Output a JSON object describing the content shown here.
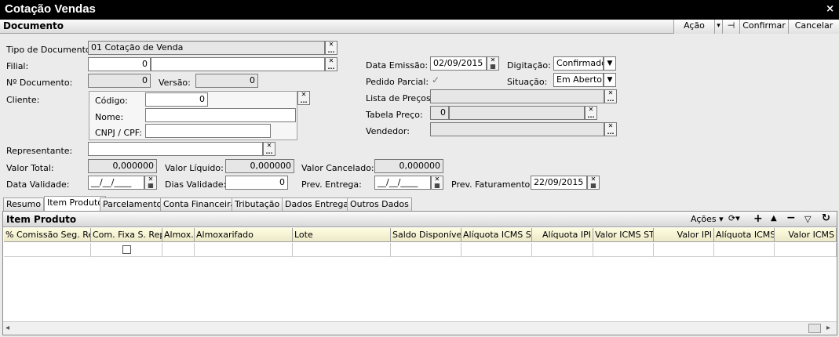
{
  "window": {
    "title": "Cotação Vendas",
    "close": "×"
  },
  "toolbar": {
    "section": "Documento",
    "acao": "Ação",
    "acao_arrow": "▾",
    "pin": "⊣",
    "confirmar": "Confirmar",
    "cancelar": "Cancelar"
  },
  "form": {
    "tipo_documento": {
      "label": "Tipo de Documento:",
      "value": "01 Cotação de Venda"
    },
    "filial": {
      "label": "Filial:",
      "code": "0",
      "name": ""
    },
    "numero": {
      "label": "Nº Documento:",
      "value": "0"
    },
    "versao": {
      "label": "Versão:",
      "value": "0"
    },
    "cliente": {
      "label": "Cliente:",
      "codigo_label": "Código:",
      "codigo": "0",
      "nome_label": "Nome:",
      "nome": "",
      "cnpj_label": "CNPJ / CPF:",
      "cnpj": ""
    },
    "representante": {
      "label": "Representante:",
      "value": ""
    },
    "valor_total": {
      "label": "Valor Total:",
      "value": "0,000000"
    },
    "valor_liquido": {
      "label": "Valor Líquido:",
      "value": "0,000000"
    },
    "valor_cancelado": {
      "label": "Valor Cancelado:",
      "value": "0,000000"
    },
    "data_validade": {
      "label": "Data Validade:",
      "value": "__/__/____"
    },
    "dias_validade": {
      "label": "Dias Validade:",
      "value": "0"
    },
    "prev_entrega": {
      "label": "Prev. Entrega:",
      "value": "__/__/____"
    },
    "prev_faturamento": {
      "label": "Prev. Faturamento:",
      "value": "22/09/2015"
    },
    "data_emissao": {
      "label": "Data Emissão:",
      "value": "02/09/2015"
    },
    "digitacao": {
      "label": "Digitação:",
      "value": "Confirmado"
    },
    "pedido_parcial": {
      "label": "Pedido Parcial:",
      "check": "✓"
    },
    "situacao": {
      "label": "Situação:",
      "value": "Em Aberto"
    },
    "lista_precos": {
      "label": "Lista de Preços:",
      "value": ""
    },
    "tabela_preco": {
      "label": "Tabela Preço:",
      "code": "0",
      "name": ""
    },
    "vendedor": {
      "label": "Vendedor:",
      "value": ""
    }
  },
  "tabs": [
    "Resumo",
    "Item Produto",
    "Parcelamento",
    "Conta Financeira",
    "Tributação",
    "Dados Entrega",
    "Outros Dados"
  ],
  "item_produto": {
    "title": "Item Produto",
    "acoes": "Ações",
    "columns": [
      "% Comissão Seg. Rep.",
      "Com. Fixa S. Rep.",
      "Almox.",
      "Almoxarifado",
      "Lote",
      "Saldo Disponível",
      "Alíquota ICMS ST",
      "Alíquota IPI",
      "Valor ICMS ST",
      "Valor IPI",
      "Alíquota ICMS",
      "Valor ICMS"
    ]
  },
  "icons": {
    "clear": "✕",
    "ellipsis": "...",
    "dropdown": "▼",
    "scroll_left": "◂",
    "scroll_right": "▸"
  }
}
